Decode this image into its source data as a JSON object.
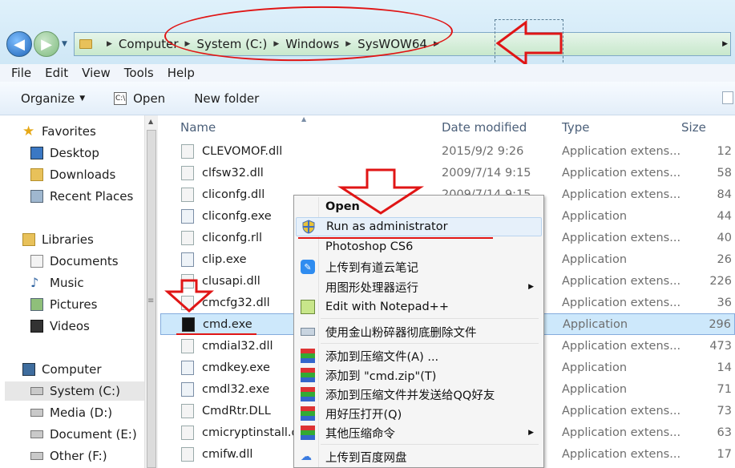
{
  "address": {
    "crumbs": [
      "Computer",
      "System (C:)",
      "Windows",
      "SysWOW64"
    ]
  },
  "menubar": [
    "File",
    "Edit",
    "View",
    "Tools",
    "Help"
  ],
  "toolbar": {
    "organize": "Organize",
    "open": "Open",
    "new_folder": "New folder"
  },
  "nav": {
    "favorites": "Favorites",
    "desktop": "Desktop",
    "downloads": "Downloads",
    "recent": "Recent Places",
    "libraries": "Libraries",
    "documents": "Documents",
    "music": "Music",
    "pictures": "Pictures",
    "videos": "Videos",
    "computer": "Computer",
    "drive_c": "System (C:)",
    "drive_d": "Media (D:)",
    "drive_e": "Document (E:)",
    "drive_f": "Other (F:)"
  },
  "columns": {
    "name": "Name",
    "date": "Date modified",
    "type": "Type",
    "size": "Size"
  },
  "files": [
    {
      "name": "CLEVOMOF.dll",
      "date": "2015/9/2 9:26",
      "type": "Application extens...",
      "size": "12"
    },
    {
      "name": "clfsw32.dll",
      "date": "2009/7/14 9:15",
      "type": "Application extens...",
      "size": "58"
    },
    {
      "name": "cliconfg.dll",
      "date": "2009/7/14 9:15",
      "type": "Application extens...",
      "size": "84"
    },
    {
      "name": "cliconfg.exe",
      "date": "",
      "type": "Application",
      "size": "44"
    },
    {
      "name": "cliconfg.rll",
      "date": "",
      "type": "Application extens...",
      "size": "40"
    },
    {
      "name": "clip.exe",
      "date": "",
      "type": "Application",
      "size": "26"
    },
    {
      "name": "clusapi.dll",
      "date": "",
      "type": "Application extens...",
      "size": "226"
    },
    {
      "name": "cmcfg32.dll",
      "date": "",
      "type": "Application extens...",
      "size": "36"
    },
    {
      "name": "cmd.exe",
      "date": "",
      "type": "Application",
      "size": "296"
    },
    {
      "name": "cmdial32.dll",
      "date": "",
      "type": "Application extens...",
      "size": "473"
    },
    {
      "name": "cmdkey.exe",
      "date": "",
      "type": "Application",
      "size": "14"
    },
    {
      "name": "cmdl32.exe",
      "date": "",
      "type": "Application",
      "size": "71"
    },
    {
      "name": "CmdRtr.DLL",
      "date": "",
      "type": "Application extens...",
      "size": "73"
    },
    {
      "name": "cmicryptinstall.dll",
      "date": "",
      "type": "Application extens...",
      "size": "63"
    },
    {
      "name": "cmifw.dll",
      "date": "",
      "type": "Application extens...",
      "size": "17"
    }
  ],
  "context_menu": [
    {
      "label": "Open"
    },
    {
      "label": "Run as administrator"
    },
    {
      "label": "Photoshop CS6"
    },
    {
      "label": "上传到有道云笔记"
    },
    {
      "label": "用图形处理器运行"
    },
    {
      "label": "Edit with Notepad++"
    },
    {
      "label": "使用金山粉碎器彻底删除文件"
    },
    {
      "label": "添加到压缩文件(A) ..."
    },
    {
      "label": "添加到 \"cmd.zip\"(T)"
    },
    {
      "label": "添加到压缩文件并发送给QQ好友"
    },
    {
      "label": "用好压打开(Q)"
    },
    {
      "label": "其他压缩命令"
    },
    {
      "label": "上传到百度网盘"
    }
  ],
  "colors": {
    "annotation_red": "#e01515",
    "selection_blue": "#cde8fb"
  }
}
